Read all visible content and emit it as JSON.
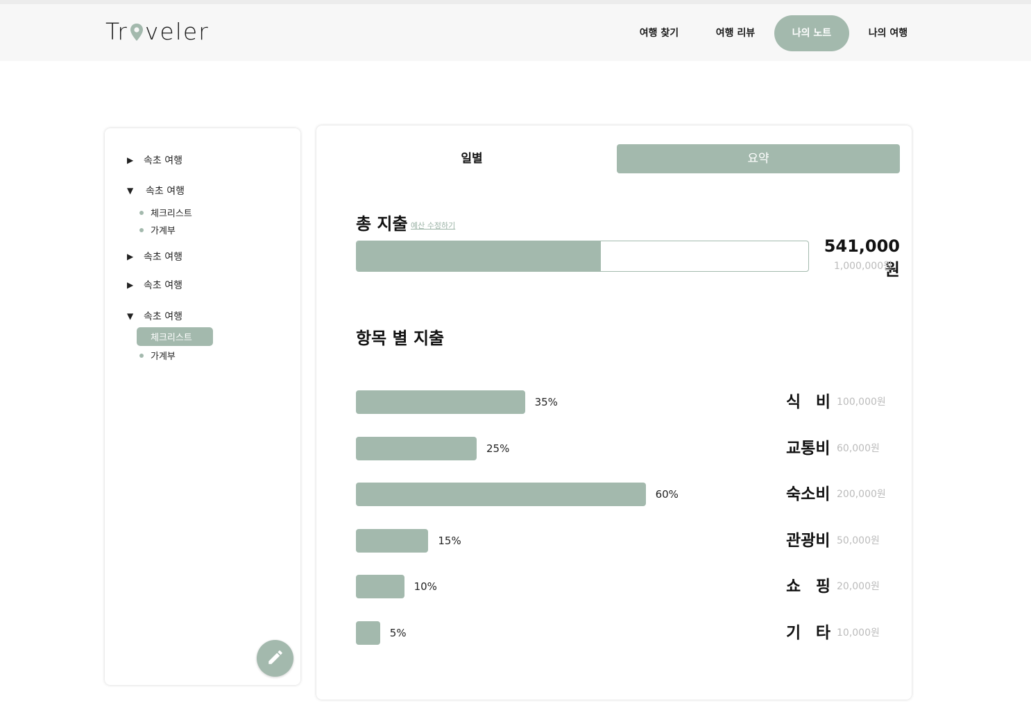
{
  "header": {
    "logo_text_pre": "Tr",
    "logo_text_post": "veler",
    "brand_color": "#a3b9ad",
    "nav": [
      {
        "label": "여행 찾기",
        "active": false
      },
      {
        "label": "여행 리뷰",
        "active": false
      },
      {
        "label": "나의 노트",
        "active": true
      },
      {
        "label": "나의 여행",
        "active": false
      }
    ]
  },
  "sidebar": {
    "trips": [
      {
        "label": "속초 여행",
        "expanded": false,
        "toggle_icon": "triangle-right-icon",
        "toggle_glyph": "▶"
      },
      {
        "label": "속초 여행",
        "expanded": true,
        "toggle_icon": "triangle-down-icon",
        "toggle_glyph": "▼",
        "children": [
          {
            "label": "체크리스트",
            "active": false
          },
          {
            "label": "가계부",
            "active": false
          }
        ]
      },
      {
        "label": "속초 여행",
        "expanded": false,
        "toggle_icon": "triangle-right-icon",
        "toggle_glyph": "▶"
      },
      {
        "label": "속초 여행",
        "expanded": false,
        "toggle_icon": "triangle-right-icon",
        "toggle_glyph": "▶"
      },
      {
        "label": "속초 여행",
        "expanded": true,
        "toggle_icon": "triangle-down-icon",
        "toggle_glyph": "▼",
        "children": [
          {
            "label": "체크리스트",
            "active": true
          },
          {
            "label": "가계부",
            "active": false
          }
        ]
      }
    ],
    "edit_button_icon": "pencil-icon"
  },
  "main": {
    "tabs": [
      {
        "label": "일별",
        "active": false
      },
      {
        "label": "요약",
        "active": true
      }
    ],
    "total": {
      "title": "총 지출",
      "edit_budget_link": "예산 수정하기",
      "spent_label": "541,000원",
      "budget_label": "1,000,000원",
      "spent": 541000,
      "budget": 1000000
    },
    "categories_title": "항목 별 지출"
  },
  "chart_data": {
    "type": "bar",
    "orientation": "horizontal",
    "categories": [
      "식 비",
      "교통비",
      "숙소비",
      "관광비",
      "쇼 핑",
      "기 타"
    ],
    "values": [
      35,
      25,
      60,
      15,
      10,
      5
    ],
    "value_labels": [
      "35%",
      "25%",
      "60%",
      "15%",
      "10%",
      "5%"
    ],
    "amount_labels": [
      "100,000원",
      "60,000원",
      "200,000원",
      "50,000원",
      "20,000원",
      "10,000원"
    ],
    "xlim": [
      0,
      100
    ],
    "bar_color": "#a3b9ad"
  }
}
